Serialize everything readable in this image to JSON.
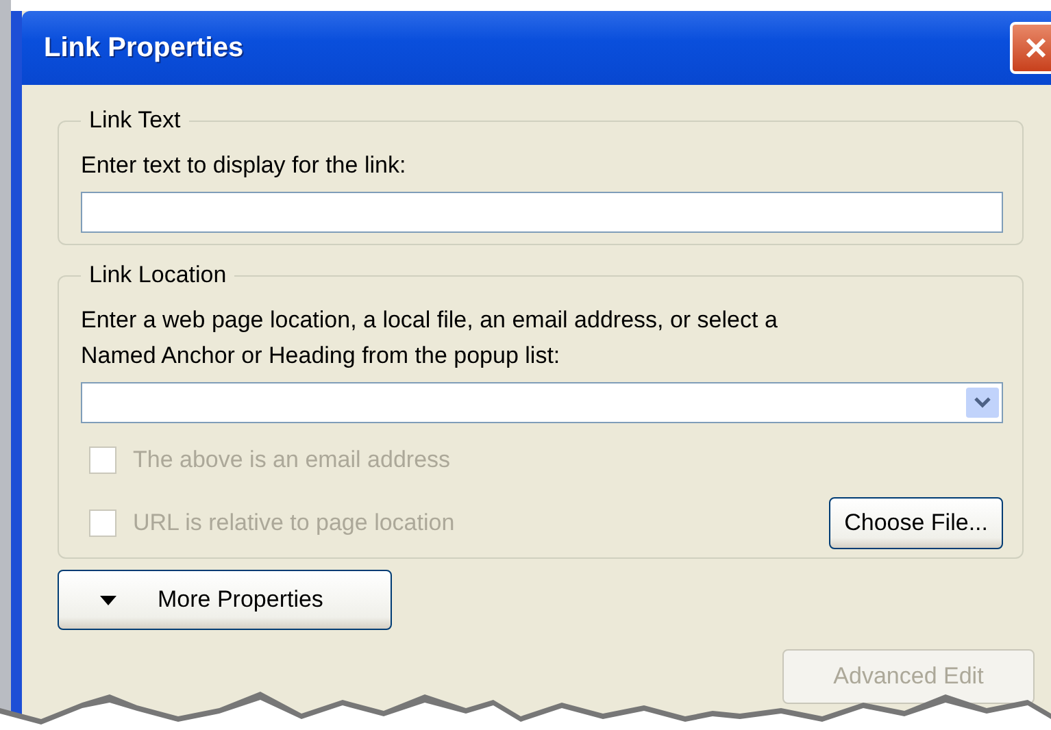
{
  "window": {
    "title": "Link Properties"
  },
  "link_text": {
    "legend": "Link Text",
    "label": "Enter text to display for the link:"
  },
  "link_location": {
    "legend": "Link Location",
    "label": "Enter a web page location, a local file, an email address, or select a\nNamed Anchor or Heading from the popup list:",
    "checkboxes": [
      {
        "label": "The above is an email address",
        "checked": false,
        "disabled": true
      },
      {
        "label": "URL is relative to page location",
        "checked": false,
        "disabled": true
      }
    ],
    "choose_button": "Choose File..."
  },
  "buttons": [
    {
      "label": "More Properties",
      "kind": "expander",
      "disabled": false
    },
    {
      "label": "Advanced Edit",
      "kind": "plain",
      "disabled": true
    }
  ]
}
